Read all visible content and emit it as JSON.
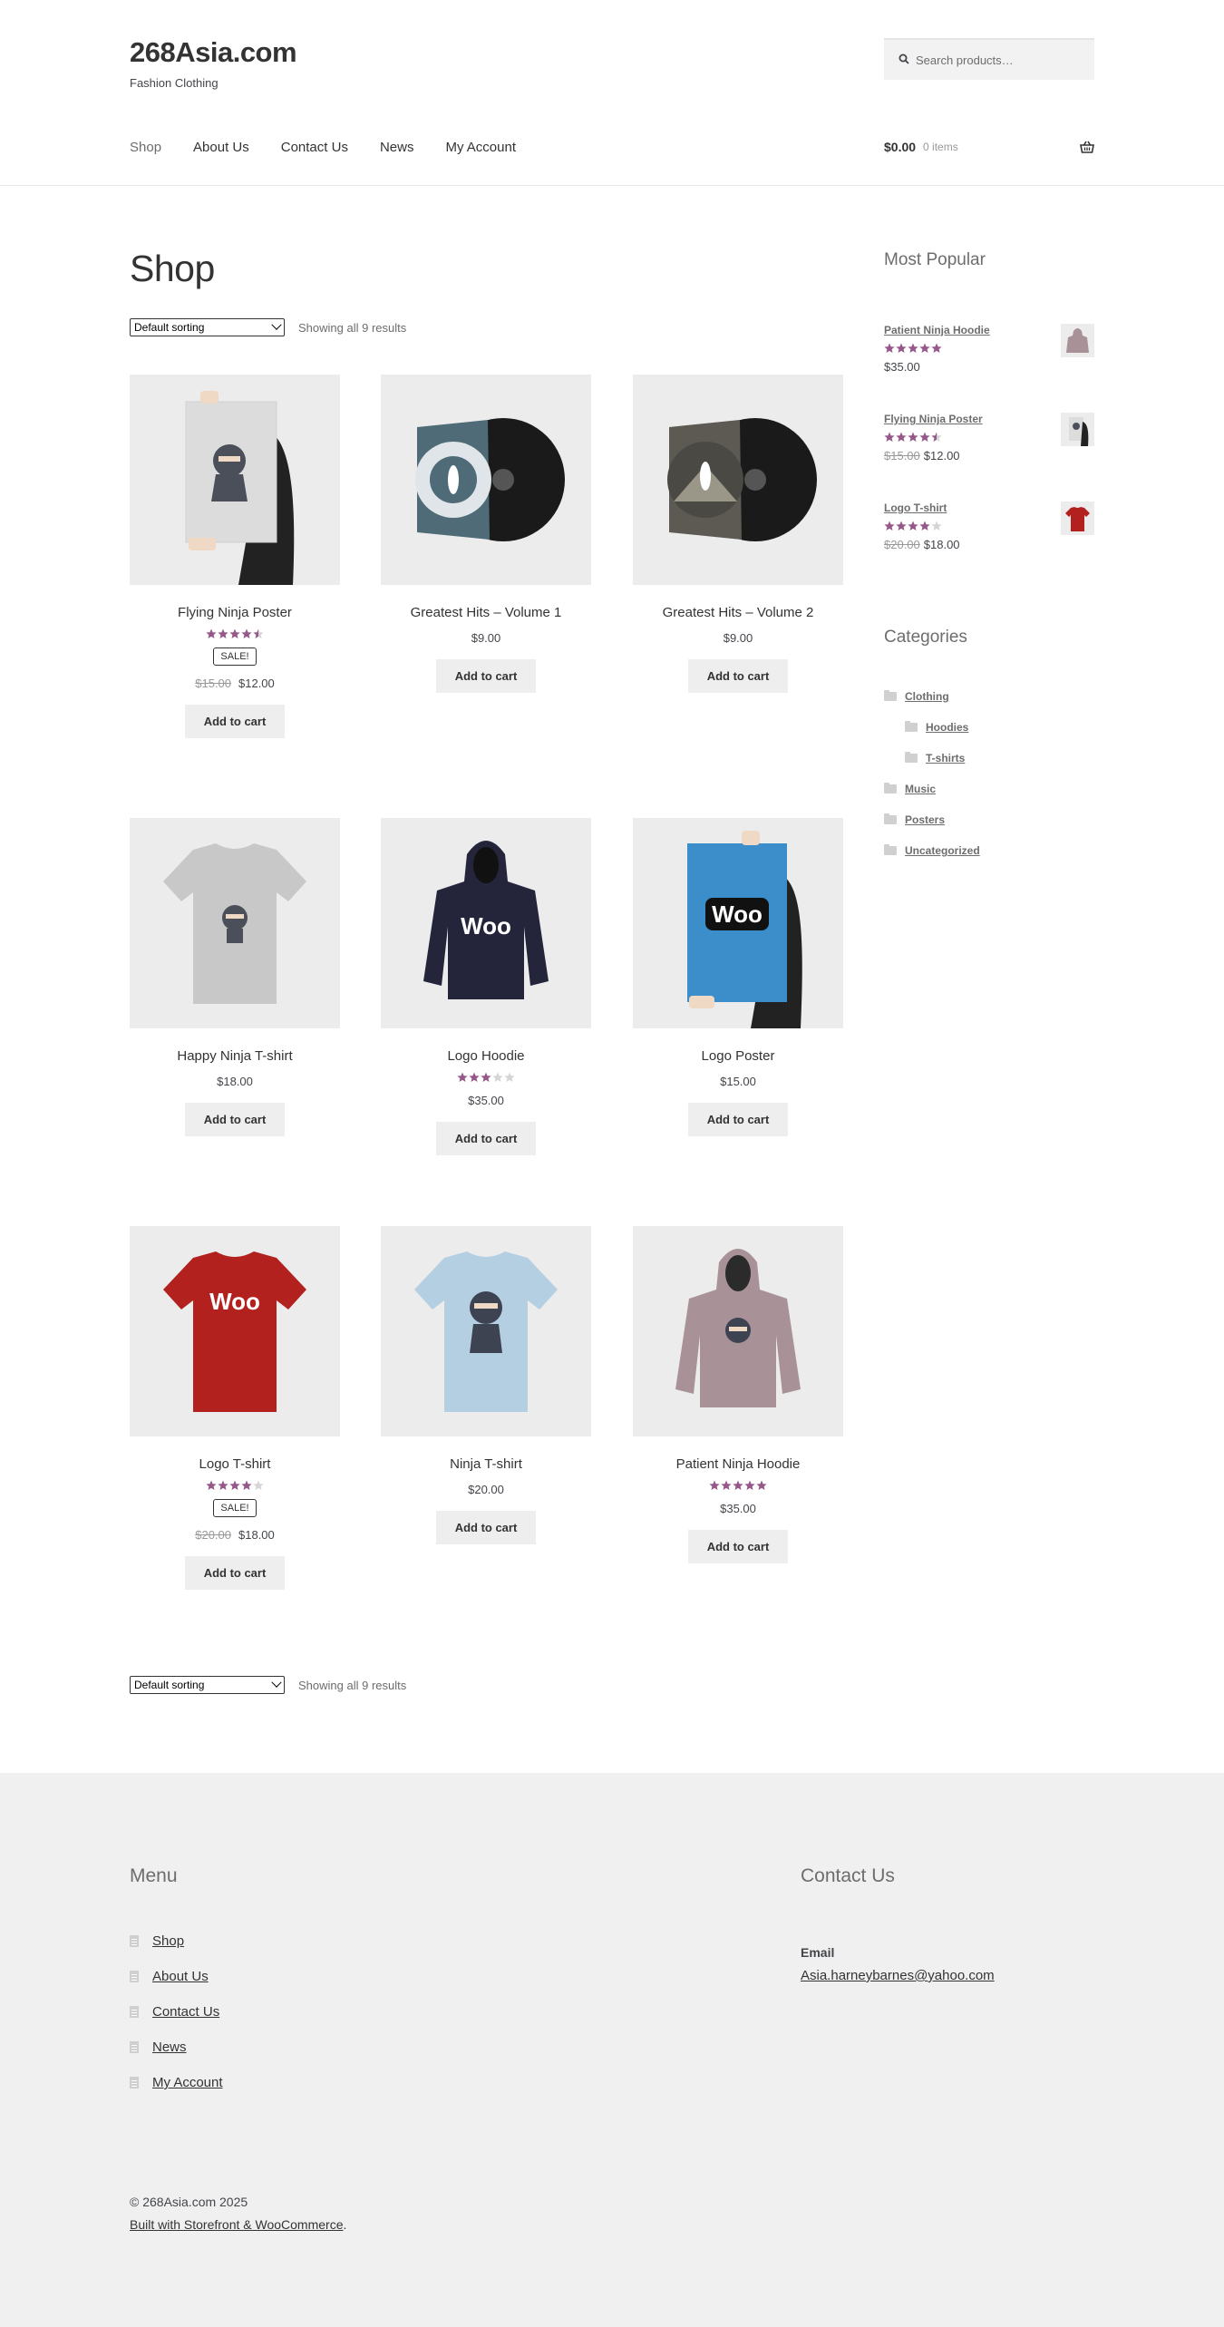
{
  "colors": {
    "star": "#96588a",
    "star_empty": "#d5d5d5",
    "button_bg": "#eeeeee",
    "footer_bg": "#f0f0f0"
  },
  "header": {
    "site_title": "268Asia.com",
    "tagline": "Fashion Clothing",
    "search_placeholder": "Search products…",
    "nav": [
      "Shop",
      "About Us",
      "Contact Us",
      "News",
      "My Account"
    ],
    "cart_amount": "$0.00",
    "cart_count": "0 items"
  },
  "shop": {
    "title": "Shop",
    "sorting": "Default sorting",
    "result_count": "Showing all 9 results",
    "add_to_cart": "Add to cart",
    "sale_badge": "SALE!",
    "products": [
      {
        "name": "Flying Ninja Poster",
        "rating": 4.5,
        "sale": true,
        "regular_price": "$15.00",
        "price": "$12.00",
        "image": "flying-ninja-poster"
      },
      {
        "name": "Greatest Hits – Volume 1",
        "rating": 0,
        "sale": false,
        "regular_price": "",
        "price": "$9.00",
        "image": "vinyl-blue"
      },
      {
        "name": "Greatest Hits – Volume 2",
        "rating": 0,
        "sale": false,
        "regular_price": "",
        "price": "$9.00",
        "image": "vinyl-dark"
      },
      {
        "name": "Happy Ninja T-shirt",
        "rating": 0,
        "sale": false,
        "regular_price": "",
        "price": "$18.00",
        "image": "grey-tshirt"
      },
      {
        "name": "Logo Hoodie",
        "rating": 3,
        "sale": false,
        "regular_price": "",
        "price": "$35.00",
        "image": "navy-hoodie"
      },
      {
        "name": "Logo Poster",
        "rating": 0,
        "sale": false,
        "regular_price": "",
        "price": "$15.00",
        "image": "woo-poster"
      },
      {
        "name": "Logo T-shirt",
        "rating": 4,
        "sale": true,
        "regular_price": "$20.00",
        "price": "$18.00",
        "image": "red-tshirt"
      },
      {
        "name": "Ninja T-shirt",
        "rating": 0,
        "sale": false,
        "regular_price": "",
        "price": "$20.00",
        "image": "blue-tshirt"
      },
      {
        "name": "Patient Ninja Hoodie",
        "rating": 5,
        "sale": false,
        "regular_price": "",
        "price": "$35.00",
        "image": "mauve-hoodie"
      }
    ]
  },
  "sidebar": {
    "popular_title": "Most Popular",
    "popular": [
      {
        "name": "Patient Ninja Hoodie",
        "rating": 5,
        "regular_price": "",
        "price": "$35.00",
        "image": "mauve-hoodie"
      },
      {
        "name": "Flying Ninja Poster",
        "rating": 4.5,
        "regular_price": "$15.00",
        "price": "$12.00",
        "image": "flying-ninja-poster"
      },
      {
        "name": "Logo T-shirt",
        "rating": 4,
        "regular_price": "$20.00",
        "price": "$18.00",
        "image": "red-tshirt"
      }
    ],
    "categories_title": "Categories",
    "categories": [
      {
        "name": "Clothing",
        "child": false
      },
      {
        "name": "Hoodies",
        "child": true
      },
      {
        "name": "T-shirts",
        "child": true
      },
      {
        "name": "Music",
        "child": false
      },
      {
        "name": "Posters",
        "child": false
      },
      {
        "name": "Uncategorized",
        "child": false
      }
    ]
  },
  "footer": {
    "menu_title": "Menu",
    "menu": [
      "Shop",
      "About Us",
      "Contact Us",
      "News",
      "My Account"
    ],
    "contact_title": "Contact Us",
    "email_label": "Email",
    "email": "Asia.harneybarnes@yahoo.com",
    "copyright": "© 268Asia.com 2025",
    "credit": "Built with Storefront & WooCommerce",
    "credit_suffix": "."
  }
}
